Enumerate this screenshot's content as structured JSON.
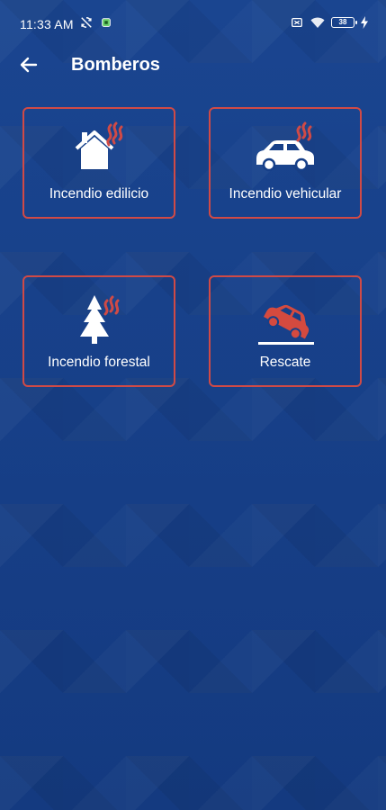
{
  "status": {
    "time": "11:33 AM",
    "battery_level": "38",
    "left_icons": [
      "sync-off-icon",
      "notification-app-icon"
    ],
    "right_icons": [
      "sim-off-icon",
      "wifi-icon",
      "battery-icon",
      "charging-icon"
    ]
  },
  "header": {
    "back_icon": "back-arrow-icon",
    "title": "Bomberos"
  },
  "colors": {
    "background": "#163f88",
    "card_border": "#d04a46",
    "smoke": "#d04a46",
    "rescue": "#d44a3f",
    "text": "#ffffff"
  },
  "cards": [
    {
      "label": "Incendio edilicio",
      "icon": "house-fire-icon"
    },
    {
      "label": "Incendio vehicular",
      "icon": "car-fire-icon"
    },
    {
      "label": "Incendio forestal",
      "icon": "tree-fire-icon"
    },
    {
      "label": "Rescate",
      "icon": "rescue-vehicle-icon"
    }
  ]
}
